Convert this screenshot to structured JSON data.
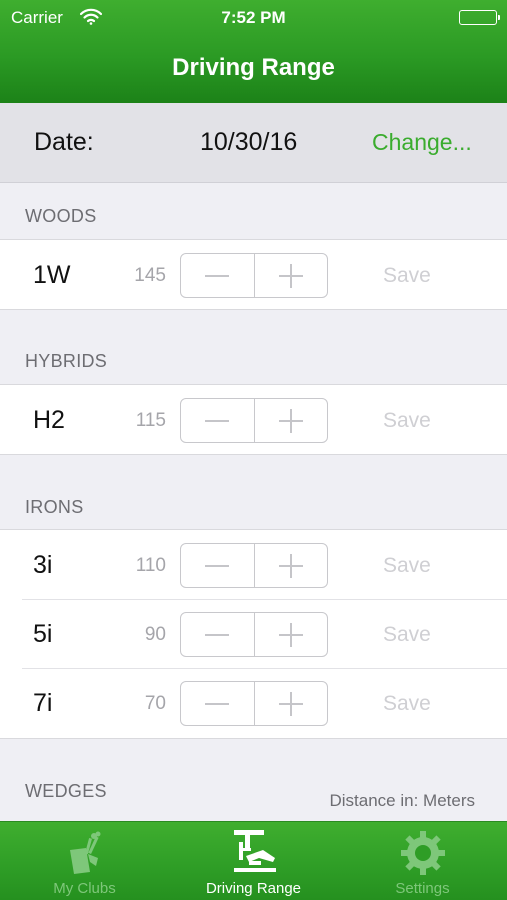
{
  "status_bar": {
    "carrier": "Carrier",
    "time": "7:52 PM"
  },
  "nav": {
    "title": "Driving Range"
  },
  "date_row": {
    "label": "Date:",
    "value": "10/30/16",
    "change_label": "Change..."
  },
  "sections": [
    {
      "header": "WOODS",
      "clubs": [
        {
          "name": "1W",
          "distance": "145",
          "save_label": "Save"
        }
      ]
    },
    {
      "header": "HYBRIDS",
      "clubs": [
        {
          "name": "H2",
          "distance": "115",
          "save_label": "Save"
        }
      ]
    },
    {
      "header": "IRONS",
      "clubs": [
        {
          "name": "3i",
          "distance": "110",
          "save_label": "Save"
        },
        {
          "name": "5i",
          "distance": "90",
          "save_label": "Save"
        },
        {
          "name": "7i",
          "distance": "70",
          "save_label": "Save"
        }
      ]
    },
    {
      "header": "WEDGES",
      "clubs": []
    }
  ],
  "footer_note": "Distance in: Meters",
  "tabs": [
    {
      "label": "My Clubs",
      "icon": "golf-bag-icon",
      "active": false
    },
    {
      "label": "Driving Range",
      "icon": "driving-range-icon",
      "active": true
    },
    {
      "label": "Settings",
      "icon": "gear-icon",
      "active": false
    }
  ],
  "colors": {
    "accent_green": "#3aac2e",
    "bar_green": "#2b9a24",
    "inactive_tab": "#7ec77a"
  }
}
